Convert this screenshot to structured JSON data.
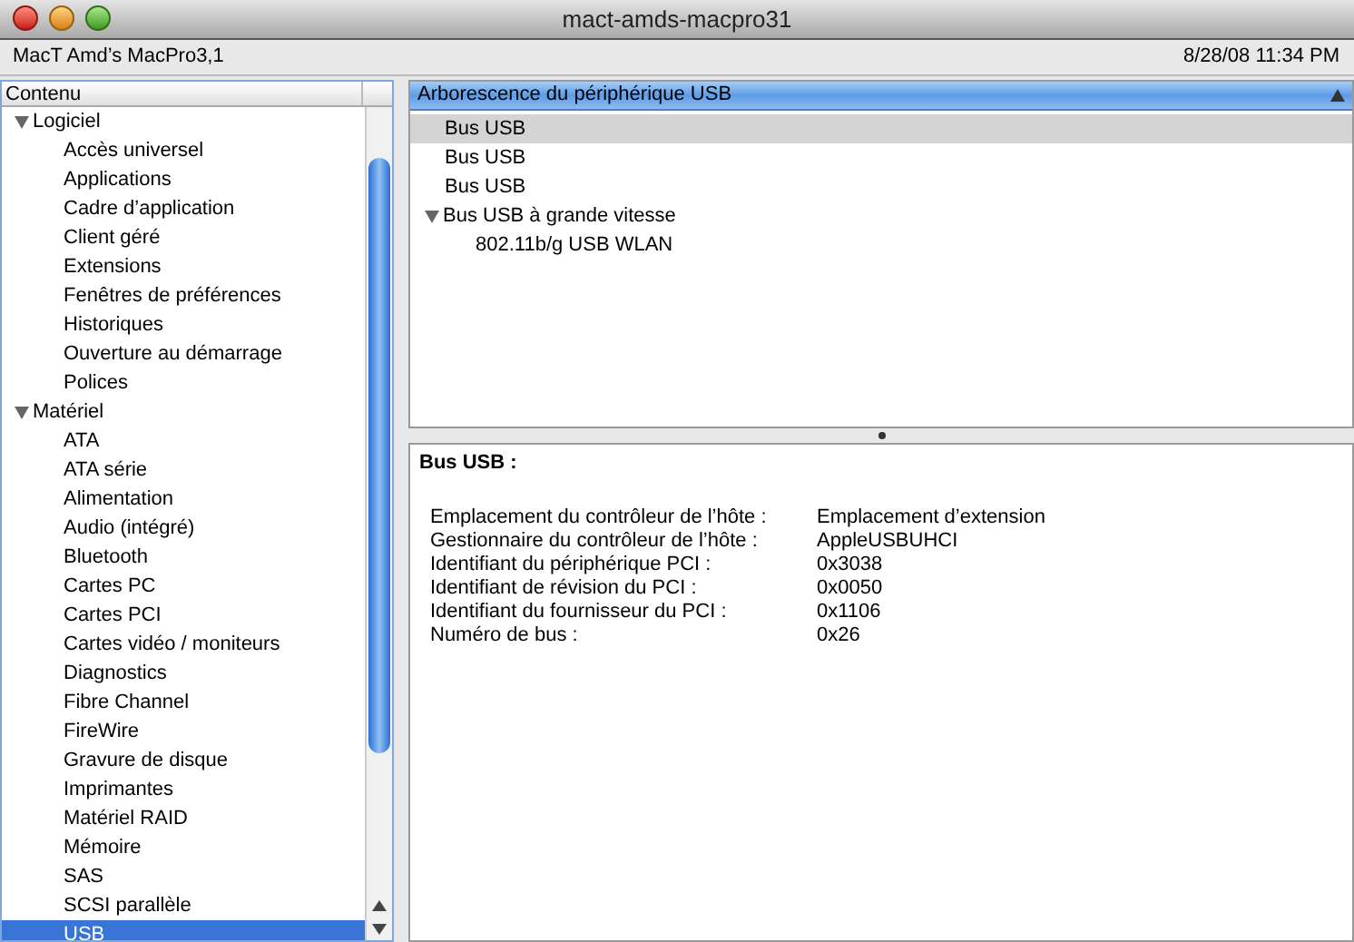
{
  "window": {
    "title": "mact-amds-macpro31"
  },
  "info_bar": {
    "computer": "MacT Amd’s MacPro3,1",
    "date": "8/28/08 11:34 PM"
  },
  "sidebar": {
    "header": "Contenu",
    "items": [
      {
        "label": "Logiciel",
        "expanded": true,
        "selected": false,
        "children": [
          {
            "label": "Accès universel",
            "selected": false
          },
          {
            "label": "Applications",
            "selected": false
          },
          {
            "label": "Cadre d’application",
            "selected": false
          },
          {
            "label": "Client géré",
            "selected": false
          },
          {
            "label": "Extensions",
            "selected": false
          },
          {
            "label": "Fenêtres de préférences",
            "selected": false
          },
          {
            "label": "Historiques",
            "selected": false
          },
          {
            "label": "Ouverture au démarrage",
            "selected": false
          },
          {
            "label": "Polices",
            "selected": false
          }
        ]
      },
      {
        "label": "Matériel",
        "expanded": true,
        "selected": false,
        "children": [
          {
            "label": "ATA",
            "selected": false
          },
          {
            "label": "ATA série",
            "selected": false
          },
          {
            "label": "Alimentation",
            "selected": false
          },
          {
            "label": "Audio (intégré)",
            "selected": false
          },
          {
            "label": "Bluetooth",
            "selected": false
          },
          {
            "label": "Cartes PC",
            "selected": false
          },
          {
            "label": "Cartes PCI",
            "selected": false
          },
          {
            "label": "Cartes vidéo / moniteurs",
            "selected": false
          },
          {
            "label": "Diagnostics",
            "selected": false
          },
          {
            "label": "Fibre Channel",
            "selected": false
          },
          {
            "label": "FireWire",
            "selected": false
          },
          {
            "label": "Gravure de disque",
            "selected": false
          },
          {
            "label": "Imprimantes",
            "selected": false
          },
          {
            "label": "Matériel RAID",
            "selected": false
          },
          {
            "label": "Mémoire",
            "selected": false
          },
          {
            "label": "SAS",
            "selected": false
          },
          {
            "label": "SCSI parallèle",
            "selected": false
          },
          {
            "label": "USB",
            "selected": true
          }
        ]
      }
    ]
  },
  "device_tree": {
    "header": "Arborescence du périphérique USB",
    "items": [
      {
        "label": "Bus USB",
        "selected": true
      },
      {
        "label": "Bus USB",
        "selected": false
      },
      {
        "label": "Bus USB",
        "selected": false
      },
      {
        "label": "Bus USB à grande vitesse",
        "selected": false,
        "expanded": true,
        "children": [
          {
            "label": "802.11b/g USB WLAN",
            "selected": false
          }
        ]
      }
    ]
  },
  "details": {
    "title": "Bus USB :",
    "rows": [
      {
        "label": "Emplacement du contrôleur de l’hôte :",
        "value": "Emplacement d’extension"
      },
      {
        "label": "Gestionnaire du contrôleur de l’hôte :",
        "value": "AppleUSBUHCI"
      },
      {
        "label": "Identifiant du périphérique PCI :",
        "value": "0x3038"
      },
      {
        "label": "Identifiant de révision du PCI :",
        "value": "0x0050"
      },
      {
        "label": "Identifiant du fournisseur du PCI :",
        "value": "0x1106"
      },
      {
        "label": "Numéro de bus :",
        "value": "0x26"
      }
    ]
  }
}
